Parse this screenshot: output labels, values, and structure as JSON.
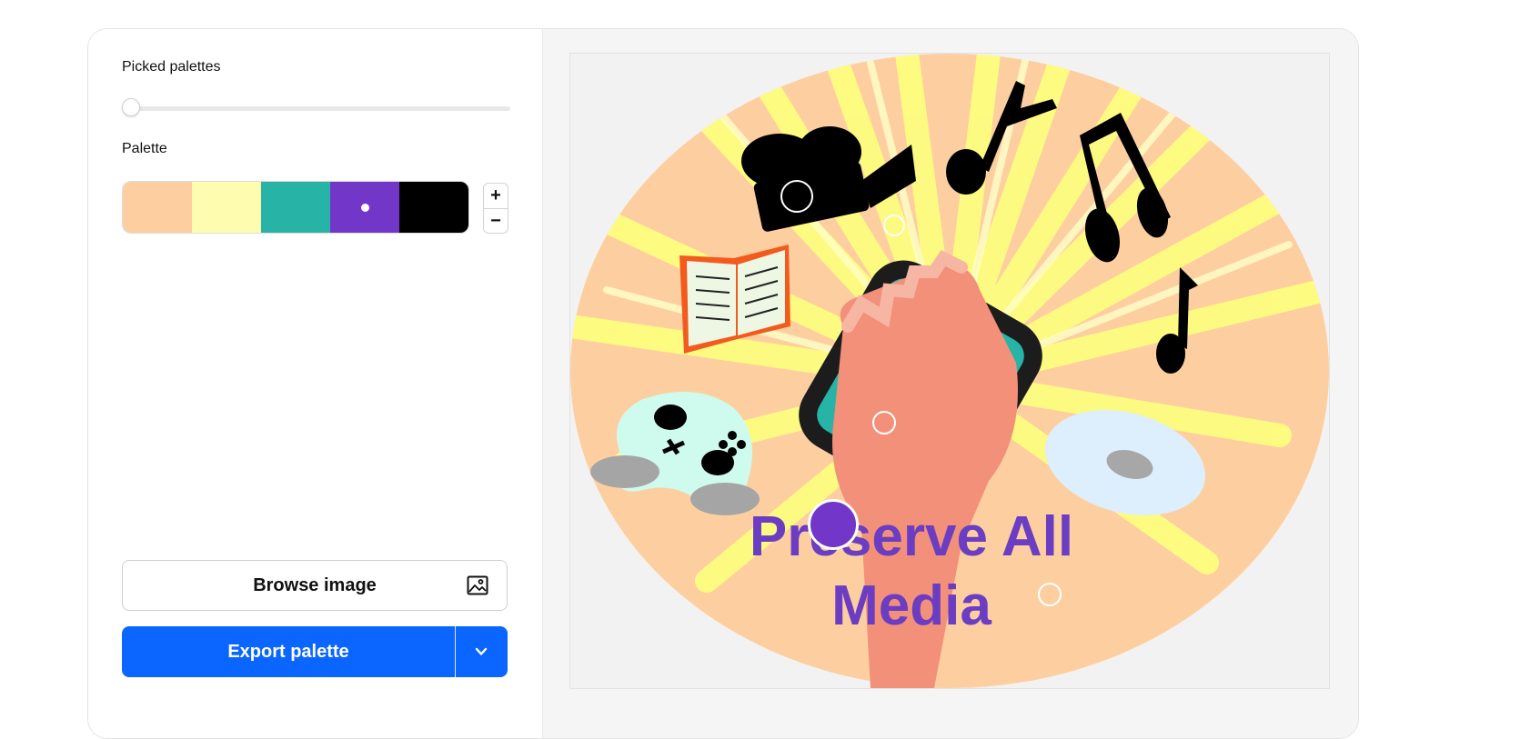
{
  "left_panel": {
    "picked_palettes_label": "Picked palettes",
    "picked_palettes_value": 0,
    "palette_label": "Palette",
    "swatches": [
      {
        "color": "#FDCFA0"
      },
      {
        "color": "#FEFDAF"
      },
      {
        "color": "#27B4A6"
      },
      {
        "color": "#7236C8",
        "selected": true
      },
      {
        "color": "#000000"
      }
    ],
    "stepper": {
      "plus": "+",
      "minus": "−"
    },
    "browse_label": "Browse image",
    "export_label": "Export palette"
  },
  "image": {
    "poster_text_line1": "Preserve All",
    "poster_text_line2": "Media",
    "text_color": "#6A3DC3"
  },
  "icons": [
    "image-icon",
    "chevron-down-icon",
    "color-picker-marker"
  ]
}
